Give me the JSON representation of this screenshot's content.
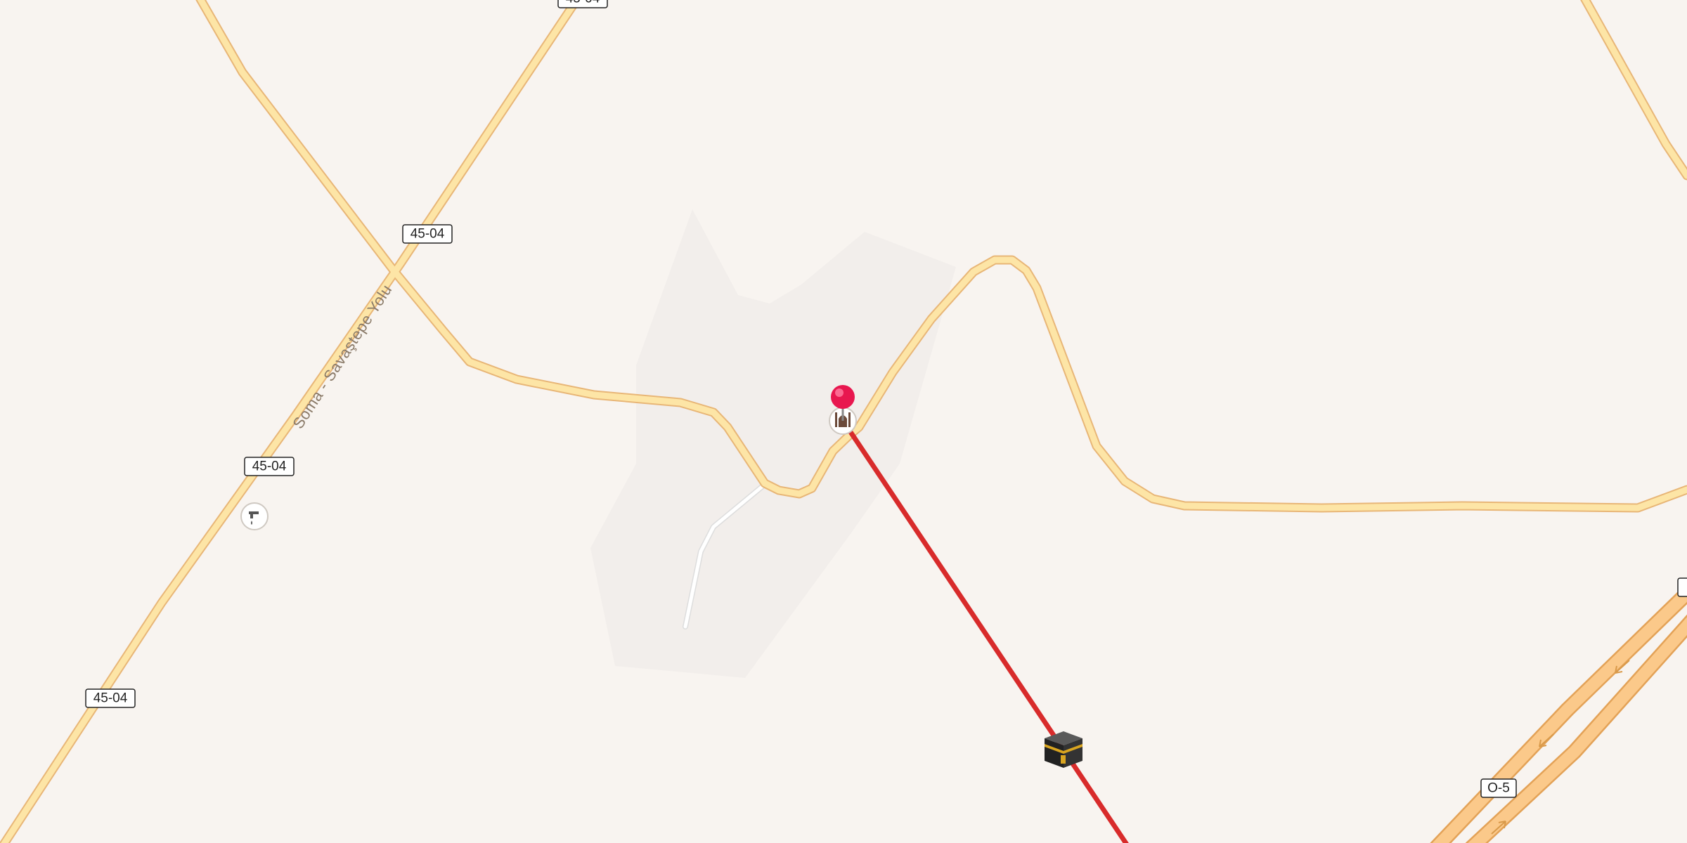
{
  "map": {
    "colors": {
      "land": "#f8f4f0",
      "landuse_area": "#f3efec",
      "road_casing": "#e8b677",
      "road_fill": "#fde5a6",
      "motorway_casing": "#e3a257",
      "motorway_fill": "#fbc98a",
      "path": "#ffffff",
      "route_line": "#d82b2b",
      "pin": "#e8174f"
    },
    "road_labels": {
      "shield_45_04": "45-04",
      "shield_o5": "O-5",
      "street_name": "Soma - Savaştepe Yolu"
    },
    "markers": {
      "pin": "location-pin",
      "mosque": "mosque-icon",
      "fountain": "drinking-water-icon",
      "kaaba": "kaaba-icon"
    }
  }
}
